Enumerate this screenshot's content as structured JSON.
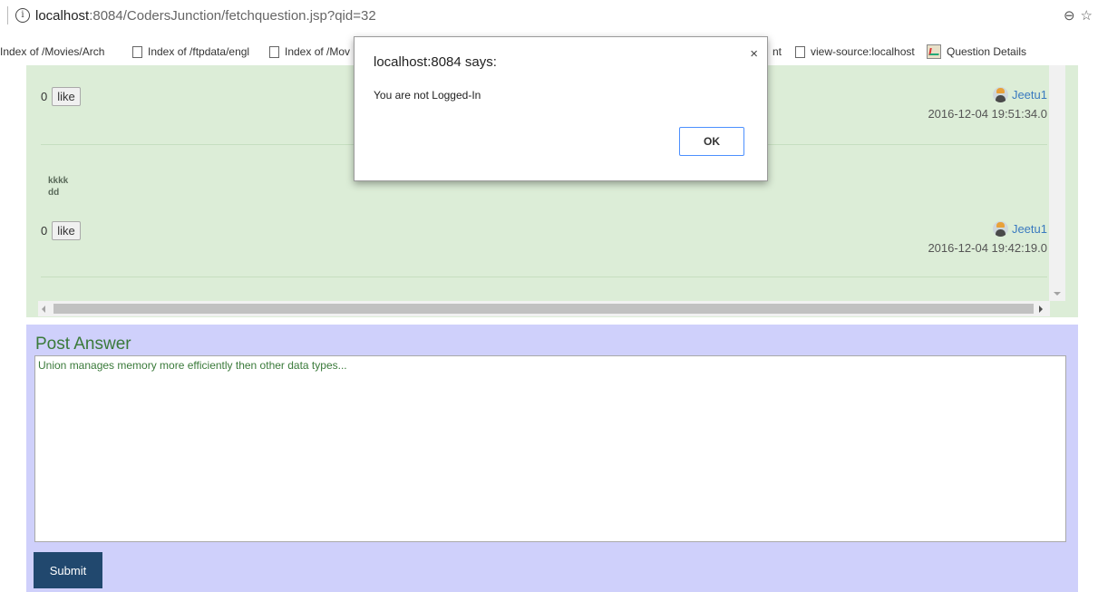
{
  "browser": {
    "url_host": "localhost",
    "url_path": ":8084/CodersJunction/fetchquestion.jsp?qid=32",
    "zoom_icon": "zoom-icon",
    "star_icon": "bookmark-star-icon"
  },
  "bookmarks": [
    {
      "label": "Index of /Movies/Arch"
    },
    {
      "label": "Index of /ftpdata/engl"
    },
    {
      "label": "Index of /Mov"
    },
    {
      "label": "nt"
    },
    {
      "label": "view-source:localhost"
    },
    {
      "label": "Question Details"
    }
  ],
  "answers": [
    {
      "likes": "0",
      "like_label": "like",
      "author": "Jeetu1",
      "timestamp": "2016-12-04 19:51:34.0"
    },
    {
      "body_line1": "kkkk",
      "body_line2": "dd",
      "likes": "0",
      "like_label": "like",
      "author": "Jeetu1",
      "timestamp": "2016-12-04 19:42:19.0"
    }
  ],
  "post": {
    "title": "Post Answer",
    "answer_text": "Union manages memory more efficiently then other data types...",
    "submit_label": "Submit"
  },
  "dialog": {
    "title": "localhost:8084 says:",
    "message": "You are not Logged-In",
    "ok_label": "OK",
    "close_glyph": "×"
  }
}
